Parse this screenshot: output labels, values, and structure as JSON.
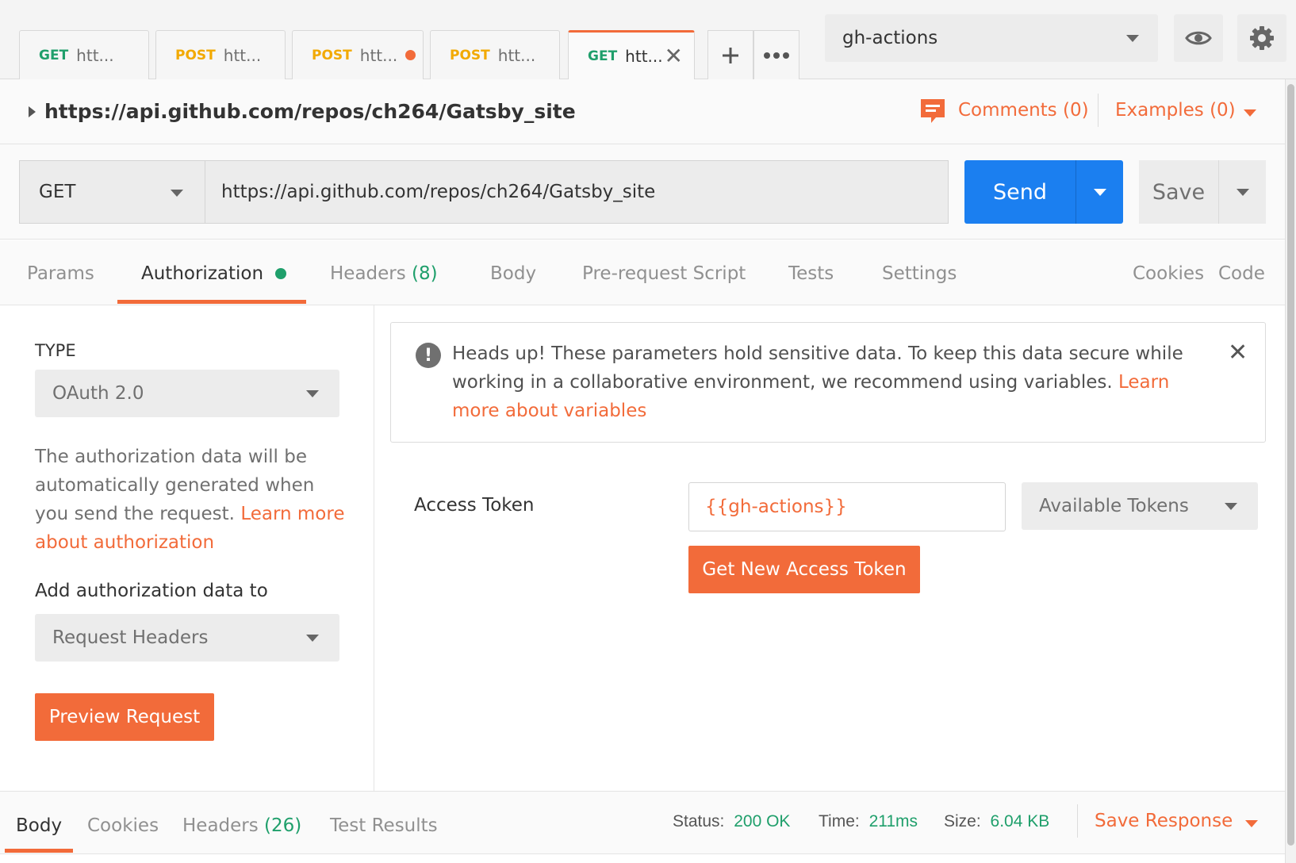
{
  "tabs": [
    {
      "method": "GET",
      "label": "htt..."
    },
    {
      "method": "POST",
      "label": "htt..."
    },
    {
      "method": "POST",
      "label": "htt..."
    },
    {
      "method": "POST",
      "label": "htt..."
    },
    {
      "method": "GET",
      "label": "htt..."
    }
  ],
  "environment": {
    "selected": "gh-actions"
  },
  "request": {
    "title": "https://api.github.com/repos/ch264/Gatsby_site",
    "comments_label": "Comments (0)",
    "examples_label": "Examples (0)",
    "method": "GET",
    "url": "https://api.github.com/repos/ch264/Gatsby_site",
    "send_label": "Send",
    "save_label": "Save"
  },
  "subtabs": {
    "params": "Params",
    "authorization": "Authorization",
    "headers": "Headers",
    "headers_count": "(8)",
    "body": "Body",
    "prerequest": "Pre-request Script",
    "tests": "Tests",
    "settings": "Settings",
    "cookies": "Cookies",
    "code": "Code"
  },
  "auth": {
    "type_label": "TYPE",
    "type_value": "OAuth 2.0",
    "description": "The authorization data will be automatically generated when you send the request.",
    "learn_more": "Learn more about authorization",
    "add_to_label": "Add authorization data to",
    "add_to_value": "Request Headers",
    "preview_button": "Preview Request"
  },
  "alert": {
    "text": "Heads up! These parameters hold sensitive data. To keep this data secure while working in a collaborative environment, we recommend using variables.",
    "link": "Learn more about variables"
  },
  "token": {
    "label": "Access Token",
    "value": "{{gh-actions}}",
    "available_label": "Available Tokens",
    "new_button": "Get New Access Token"
  },
  "response": {
    "tabs": {
      "body": "Body",
      "cookies": "Cookies",
      "headers": "Headers",
      "headers_count": "(26)",
      "test_results": "Test Results"
    },
    "status_label": "Status:",
    "status_value": "200 OK",
    "time_label": "Time:",
    "time_value": "211ms",
    "size_label": "Size:",
    "size_value": "6.04 KB",
    "save_response": "Save Response"
  },
  "colors": {
    "accent": "#f26b3a",
    "send_blue": "#1b7ff0",
    "get_green": "#1f9f6b",
    "post_yellow": "#f2a900"
  },
  "icons": [
    "plus-icon",
    "more-icon",
    "eye-icon",
    "gear-icon",
    "comment-icon",
    "info-icon",
    "close-icon",
    "caret-down-icon"
  ]
}
